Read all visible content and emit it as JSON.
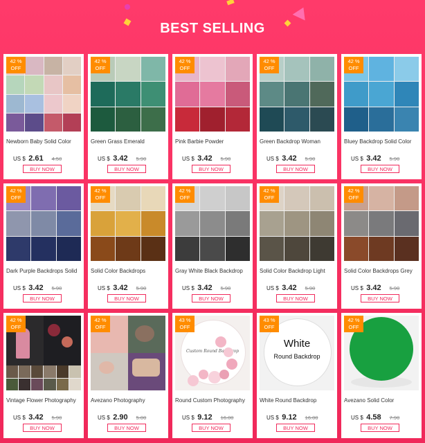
{
  "header": {
    "title": "BEST SELLING"
  },
  "colors": {
    "background": "#f0285a",
    "badge": "#ff8c00",
    "accent": "#f0285a"
  },
  "products": [
    {
      "name": "Newborn Baby Solid Color",
      "discount": "42 %",
      "off": "OFF",
      "currency": "US $",
      "price": "2.61",
      "old_price": "4.50",
      "buy": "BUY NOW"
    },
    {
      "name": "Green Grass Emerald",
      "discount": "42 %",
      "off": "OFF",
      "currency": "US $",
      "price": "3.42",
      "old_price": "5.90",
      "buy": "BUY NOW"
    },
    {
      "name": "Pink Barbie Powder",
      "discount": "42 %",
      "off": "OFF",
      "currency": "US $",
      "price": "3.42",
      "old_price": "5.90",
      "buy": "BUY NOW"
    },
    {
      "name": "Green Backdrop Woman",
      "discount": "42 %",
      "off": "OFF",
      "currency": "US $",
      "price": "3.42",
      "old_price": "5.90",
      "buy": "BUY NOW"
    },
    {
      "name": "Bluey Backdrop Solid Color",
      "discount": "42 %",
      "off": "OFF",
      "currency": "US $",
      "price": "3.42",
      "old_price": "5.90",
      "buy": "BUY NOW"
    },
    {
      "name": "Dark Purple Backdrops Solid",
      "discount": "42 %",
      "off": "OFF",
      "currency": "US $",
      "price": "3.42",
      "old_price": "5.90",
      "buy": "BUY NOW"
    },
    {
      "name": "Solid Color Backdrops",
      "discount": "42 %",
      "off": "OFF",
      "currency": "US $",
      "price": "3.42",
      "old_price": "5.90",
      "buy": "BUY NOW"
    },
    {
      "name": "Gray White Black Backdrop",
      "discount": "42 %",
      "off": "OFF",
      "currency": "US $",
      "price": "3.42",
      "old_price": "5.90",
      "buy": "BUY NOW"
    },
    {
      "name": "Solid Color Backdrop Light",
      "discount": "42 %",
      "off": "OFF",
      "currency": "US $",
      "price": "3.42",
      "old_price": "5.90",
      "buy": "BUY NOW"
    },
    {
      "name": "Solid Color Backdrops Grey",
      "discount": "42 %",
      "off": "OFF",
      "currency": "US $",
      "price": "3.42",
      "old_price": "5.90",
      "buy": "BUY NOW"
    },
    {
      "name": "Vintage Flower Photography",
      "discount": "42 %",
      "off": "OFF",
      "currency": "US $",
      "price": "3.42",
      "old_price": "5.90",
      "buy": "BUY NOW"
    },
    {
      "name": "Avezano Photography",
      "discount": "42 %",
      "off": "OFF",
      "currency": "US $",
      "price": "2.90",
      "old_price": "5.00",
      "buy": "BUY NOW"
    },
    {
      "name": "Round Custom Photography",
      "discount": "43 %",
      "off": "OFF",
      "currency": "US $",
      "price": "9.12",
      "old_price": "16.00",
      "buy": "BUY NOW",
      "image_text": "Custom Round Backdrop"
    },
    {
      "name": "White Round Backdrop",
      "discount": "43 %",
      "off": "OFF",
      "currency": "US $",
      "price": "9.12",
      "old_price": "16.00",
      "buy": "BUY NOW",
      "image_text_1": "White",
      "image_text_2": "Round Backdrop"
    },
    {
      "name": "Avezano Solid Color",
      "discount": "42 %",
      "off": "OFF",
      "currency": "US $",
      "price": "4.58",
      "old_price": "7.90",
      "buy": "BUY NOW"
    }
  ]
}
